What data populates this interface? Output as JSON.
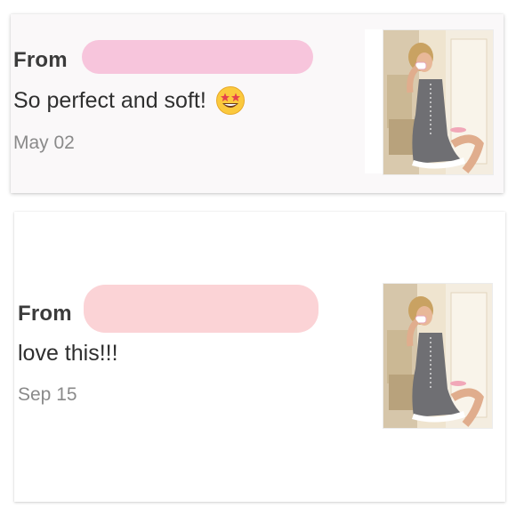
{
  "reviews": [
    {
      "from_label": "From",
      "message": "So perfect and soft!",
      "emoji": "star-struck-emoji",
      "date": "May 02",
      "redaction_color": "#f7c5dc",
      "image": "product-photo-nightdress"
    },
    {
      "from_label": "From",
      "message": "love this!!!",
      "date": "Sep 15",
      "redaction_color": "#fbd3d6",
      "image": "product-photo-nightdress"
    }
  ]
}
